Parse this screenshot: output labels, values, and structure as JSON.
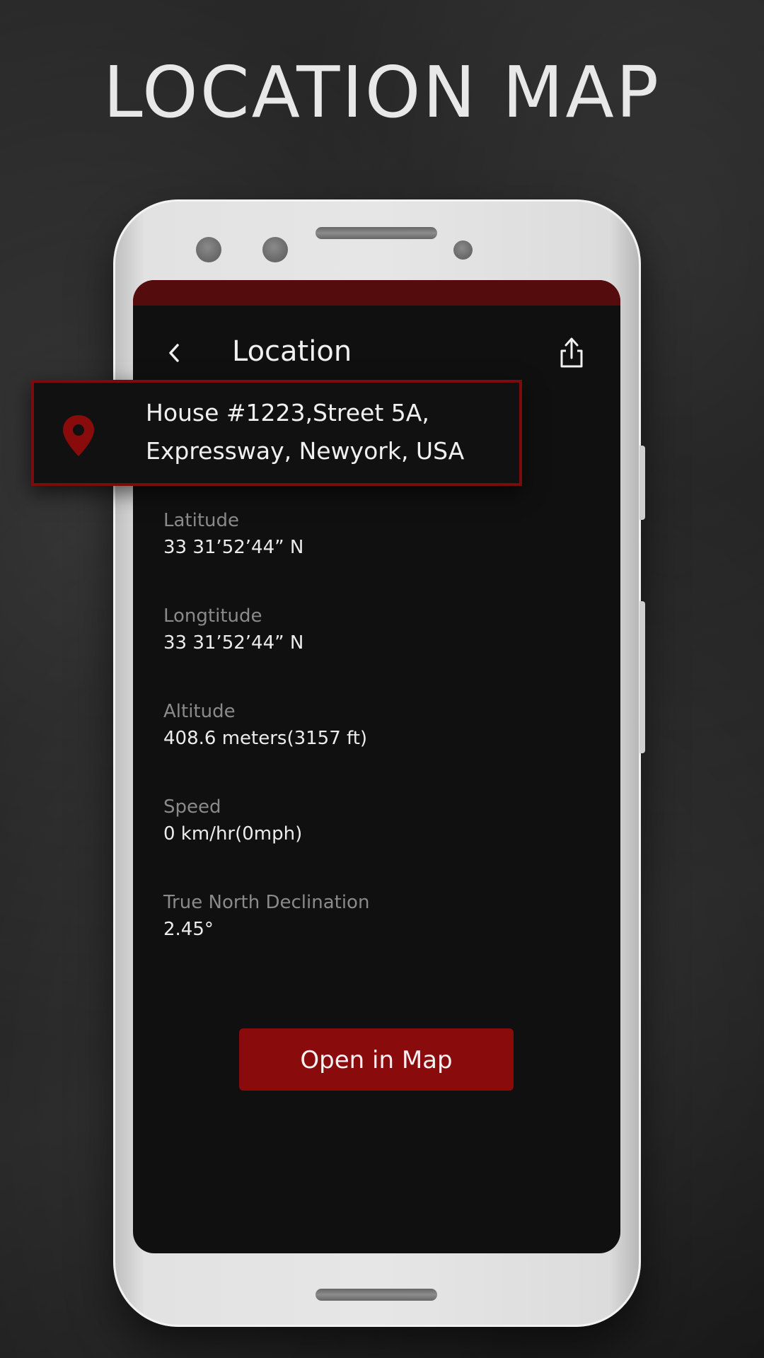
{
  "headline": "LOCATION MAP",
  "colors": {
    "accent": "#8a0b0b",
    "status_bar": "#540c0c",
    "screen_bg": "#101010",
    "label": "#8a8a8a",
    "value": "#ececec"
  },
  "icons": {
    "back": "chevron-left-icon",
    "share": "share-icon",
    "location": "map-pin-icon"
  },
  "screen": {
    "title": "Location"
  },
  "address": {
    "line1": "House #1223,Street 5A,",
    "line2": "Expressway, Newyork, USA"
  },
  "fields": [
    {
      "label": "Latitude",
      "value": "33 31’52’44” N"
    },
    {
      "label": "Longtitude",
      "value": "33 31’52’44” N"
    },
    {
      "label": "Altitude",
      "value": "408.6 meters(3157 ft)"
    },
    {
      "label": "Speed",
      "value": "0 km/hr(0mph)"
    },
    {
      "label": "True North Declination",
      "value": "2.45°"
    }
  ],
  "actions": {
    "open_map_label": "Open in Map"
  }
}
